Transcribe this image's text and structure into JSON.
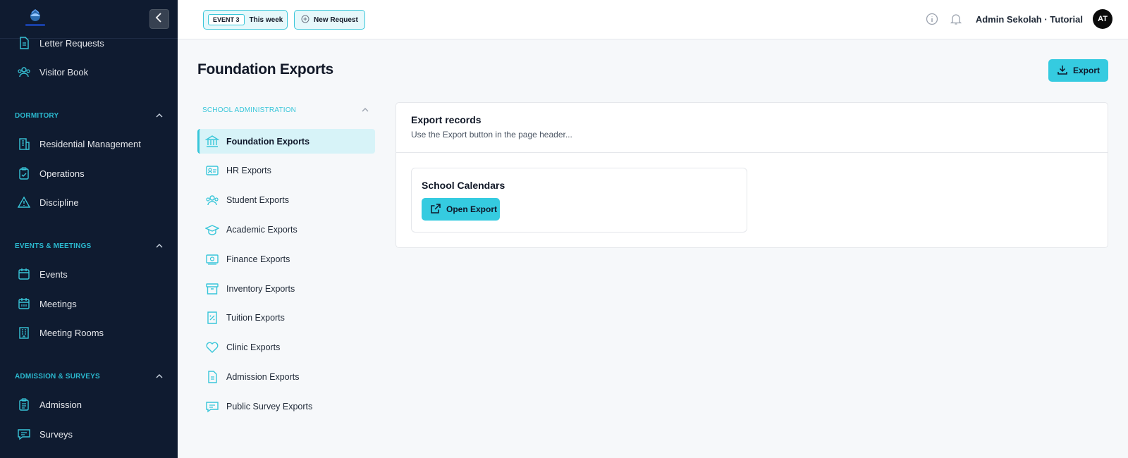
{
  "sidebar": {
    "collapse_icon": "chevron-left-icon",
    "items_top": [
      {
        "label": "Letter Requests",
        "icon": "document-icon"
      },
      {
        "label": "Visitor Book",
        "icon": "users-icon"
      }
    ],
    "sections": [
      {
        "title": "DORMITORY",
        "items": [
          {
            "label": "Residential Management",
            "icon": "building-icon"
          },
          {
            "label": "Operations",
            "icon": "clipboard-check-icon"
          },
          {
            "label": "Discipline",
            "icon": "warning-icon"
          }
        ]
      },
      {
        "title": "EVENTS & MEETINGS",
        "items": [
          {
            "label": "Events",
            "icon": "calendar-icon"
          },
          {
            "label": "Meetings",
            "icon": "calendar-grid-icon"
          },
          {
            "label": "Meeting Rooms",
            "icon": "building-icon"
          }
        ]
      },
      {
        "title": "ADMISSION & SURVEYS",
        "items": [
          {
            "label": "Admission",
            "icon": "clipboard-icon"
          },
          {
            "label": "Surveys",
            "icon": "message-icon"
          }
        ]
      }
    ]
  },
  "topbar": {
    "event_tag": "EVENT 3",
    "event_period": "This week",
    "new_request": "New Request",
    "user_name": "Admin Sekolah · Tutorial",
    "avatar_initials": "AT"
  },
  "page": {
    "title": "Foundation Exports",
    "export_label": "Export"
  },
  "subnav": {
    "section": "SCHOOL ADMINISTRATION",
    "items": [
      {
        "label": "Foundation Exports",
        "icon": "bank-icon",
        "active": true
      },
      {
        "label": "HR Exports",
        "icon": "id-card-icon"
      },
      {
        "label": "Student Exports",
        "icon": "users-icon"
      },
      {
        "label": "Academic Exports",
        "icon": "graduation-cap-icon"
      },
      {
        "label": "Finance Exports",
        "icon": "cash-icon"
      },
      {
        "label": "Inventory Exports",
        "icon": "archive-icon"
      },
      {
        "label": "Tuition Exports",
        "icon": "receipt-icon"
      },
      {
        "label": "Clinic Exports",
        "icon": "heart-icon"
      },
      {
        "label": "Admission Exports",
        "icon": "document-icon"
      },
      {
        "label": "Public Survey Exports",
        "icon": "message-icon"
      }
    ]
  },
  "card": {
    "title": "Export records",
    "subtitle": "Use the Export button in the page header...",
    "inner_title": "School Calendars",
    "open_label": "Open Export"
  },
  "colors": {
    "accent": "#35cbe0",
    "sidebar_bg": "#0f1b30",
    "section_text": "#2bb9cf",
    "active_bg": "#d7f3f8"
  }
}
